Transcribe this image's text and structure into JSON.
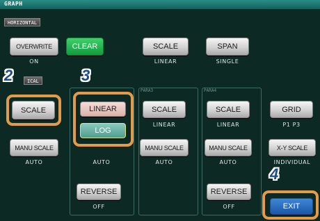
{
  "title": "GRAPH",
  "horizontal": {
    "tag": "HORIZONTAL",
    "overwrite_label": "OVERWRITE",
    "overwrite_value": "ON",
    "clear_label": "CLEAR",
    "scale_label": "SCALE",
    "scale_value": "LINEAR",
    "span_label": "SPAN",
    "span_value": "SINGLE"
  },
  "vertical": {
    "tag": "ICAL",
    "scale_label": "SCALE",
    "manu_scale_label": "MANU SCALE",
    "manu_scale_value": "AUTO",
    "popup": {
      "linear_label": "LINEAR",
      "log_label": "LOG",
      "manu_value": "AUTO",
      "reverse_label": "REVERSE",
      "reverse_value": "OFF"
    },
    "para3": {
      "label": "PARA3",
      "scale_label": "SCALE",
      "scale_value": "LINEAR",
      "manu_scale_label": "MANU SCALE",
      "manu_scale_value": "AUTO"
    },
    "para4": {
      "label": "PARA4",
      "scale_label": "SCALE",
      "scale_value": "LINEAR",
      "manu_scale_label": "MANU SCALE",
      "manu_scale_value": "AUTO",
      "reverse_label": "REVERSE",
      "reverse_value": "OFF"
    },
    "grid_label": "GRID",
    "grid_value": "P1 P3",
    "xy_scale_label": "X-Y SCALE",
    "xy_scale_value": "INDIVIDUAL"
  },
  "exit_label": "EXIT",
  "steps": {
    "s2": "2",
    "s3": "3",
    "s4": "4"
  },
  "colors": {
    "highlight": "#e39a4a",
    "step_number": "#1e4c8c",
    "clear_button": "#1fb14a",
    "exit_button": "#2a6fc4"
  }
}
